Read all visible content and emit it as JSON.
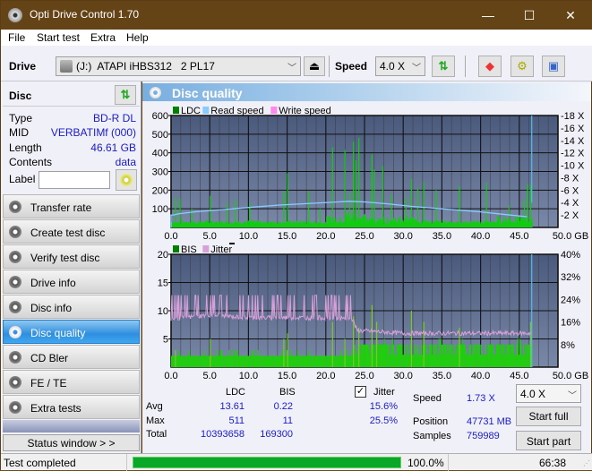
{
  "window": {
    "title": "Opti Drive Control 1.70",
    "minimize_label": "—",
    "maximize_label": "☐",
    "close_label": "✕"
  },
  "menu": [
    "File",
    "Start test",
    "Extra",
    "Help"
  ],
  "toolbar": {
    "drive_label": "Drive",
    "drive_value": "(J:)  ATAPI iHBS312   2 PL17",
    "speed_label": "Speed",
    "speed_value": "4.0 X",
    "icons": [
      "eject-icon",
      "refresh-icon",
      "erase-icon",
      "settings-icon",
      "save-icon"
    ]
  },
  "disc": {
    "header": "Disc",
    "rows": [
      {
        "key": "Type",
        "value": "BD-R DL"
      },
      {
        "key": "MID",
        "value": "VERBATIMf (000)"
      },
      {
        "key": "Length",
        "value": "46.61 GB"
      },
      {
        "key": "Contents",
        "value": "data"
      }
    ],
    "label_key": "Label",
    "label_value": ""
  },
  "nav": [
    {
      "label": "Transfer rate",
      "active": false
    },
    {
      "label": "Create test disc",
      "active": false
    },
    {
      "label": "Verify test disc",
      "active": false
    },
    {
      "label": "Drive info",
      "active": false
    },
    {
      "label": "Disc info",
      "active": false
    },
    {
      "label": "Disc quality",
      "active": true
    },
    {
      "label": "CD Bler",
      "active": false
    },
    {
      "label": "FE / TE",
      "active": false
    },
    {
      "label": "Extra tests",
      "active": false
    }
  ],
  "status_window_label": "Status window > >",
  "panel_title": "Disc quality",
  "chart_data": [
    {
      "type": "bar",
      "title": "LDC",
      "legend": [
        {
          "name": "LDC",
          "color": "#008000"
        },
        {
          "name": "Read speed",
          "color": "#88ccff"
        },
        {
          "name": "Write speed",
          "color": "#ff88ee"
        }
      ],
      "legend_position": "top-left",
      "xlabel": "GB",
      "xlim": [
        0,
        50
      ],
      "x_ticks": [
        "0.0",
        "5.0",
        "10.0",
        "15.0",
        "20.0",
        "25.0",
        "30.0",
        "35.0",
        "40.0",
        "45.0",
        "50.0 GB"
      ],
      "ylim": [
        0,
        600
      ],
      "y_ticks": [
        "100",
        "200",
        "300",
        "400",
        "500",
        "600"
      ],
      "y2lim": [
        0,
        18
      ],
      "y2_ticks": [
        "2 X",
        "4 X",
        "6 X",
        "8 X",
        "10 X",
        "12 X",
        "14 X",
        "16 X",
        "18 X"
      ],
      "grid": true,
      "end_marker_gb": 46.61,
      "ldc_peaks": [
        [
          0.5,
          160
        ],
        [
          1.1,
          155
        ],
        [
          2.6,
          100
        ],
        [
          5.0,
          170
        ],
        [
          7.2,
          130
        ],
        [
          8.2,
          150
        ],
        [
          10.1,
          130
        ],
        [
          14.5,
          195
        ],
        [
          15.0,
          290
        ],
        [
          17.7,
          195
        ],
        [
          19.2,
          100
        ],
        [
          20.8,
          430
        ],
        [
          22.4,
          415
        ],
        [
          23.0,
          185
        ],
        [
          23.5,
          460
        ],
        [
          23.8,
          360
        ],
        [
          24.2,
          480
        ],
        [
          25.9,
          390
        ],
        [
          26.2,
          310
        ],
        [
          27.3,
          330
        ],
        [
          28.4,
          175
        ],
        [
          30.3,
          160
        ],
        [
          31.0,
          260
        ],
        [
          31.8,
          210
        ],
        [
          32.6,
          240
        ],
        [
          34.2,
          200
        ],
        [
          37.2,
          220
        ],
        [
          40.7,
          240
        ],
        [
          43.6,
          120
        ],
        [
          45.6,
          150
        ],
        [
          46.0,
          230
        ],
        [
          46.4,
          230
        ]
      ],
      "ldc_baseline": 15,
      "read_speed": [
        [
          0.0,
          2.0
        ],
        [
          0.3,
          2.0
        ],
        [
          1.0,
          2.2
        ],
        [
          3.0,
          2.5
        ],
        [
          5.0,
          2.7
        ],
        [
          8.0,
          3.0
        ],
        [
          11.0,
          3.3
        ],
        [
          14.0,
          3.6
        ],
        [
          17.0,
          3.8
        ],
        [
          20.0,
          4.0
        ],
        [
          23.0,
          4.2
        ],
        [
          25.0,
          4.1
        ],
        [
          28.0,
          3.8
        ],
        [
          31.0,
          3.4
        ],
        [
          34.0,
          3.1
        ],
        [
          37.0,
          2.8
        ],
        [
          40.0,
          2.5
        ],
        [
          43.0,
          2.1
        ],
        [
          46.0,
          1.73
        ]
      ]
    },
    {
      "type": "bar",
      "title": "BIS / Jitter",
      "legend": [
        {
          "name": "BIS",
          "color": "#008000"
        },
        {
          "name": "Jitter",
          "color": "#d8a0d8"
        }
      ],
      "legend_position": "top-left",
      "xlabel": "GB",
      "xlim": [
        0,
        50
      ],
      "x_ticks": [
        "0.0",
        "5.0",
        "10.0",
        "15.0",
        "20.0",
        "25.0",
        "30.0",
        "35.0",
        "40.0",
        "45.0",
        "50.0 GB"
      ],
      "ylim": [
        0,
        20
      ],
      "y_ticks": [
        "5",
        "10",
        "15",
        "20"
      ],
      "y2lim": [
        0,
        40
      ],
      "y2_ticks": [
        "8%",
        "16%",
        "24%",
        "32%",
        "40%"
      ],
      "grid": true,
      "end_marker_gb": 46.61,
      "bis_baseline_first": 2,
      "bis_baseline_second": 4,
      "bis_peaks": [
        [
          0.5,
          3
        ],
        [
          5.0,
          5
        ],
        [
          14.5,
          5
        ],
        [
          15.0,
          6
        ],
        [
          20.8,
          8
        ],
        [
          22.4,
          5
        ],
        [
          23.5,
          9
        ],
        [
          24.2,
          7
        ],
        [
          25.9,
          11
        ],
        [
          26.5,
          8
        ],
        [
          31.0,
          10
        ],
        [
          32.6,
          8
        ],
        [
          37.2,
          7
        ],
        [
          46.4,
          8
        ]
      ],
      "jitter_percent": [
        [
          0.0,
          17
        ],
        [
          5.0,
          18.5
        ],
        [
          10.0,
          17.5
        ],
        [
          15.0,
          17.5
        ],
        [
          20.0,
          17.5
        ],
        [
          23.5,
          17
        ],
        [
          24.0,
          13
        ],
        [
          30.0,
          12
        ],
        [
          40.0,
          12
        ],
        [
          46.5,
          12
        ]
      ],
      "jitter_spike_percent": 25.5
    }
  ],
  "stats": {
    "col_ldc": "LDC",
    "col_bis": "BIS",
    "jitter_label": "Jitter",
    "jitter_checked": true,
    "rows": [
      {
        "label": "Avg",
        "ldc": "13.61",
        "bis": "0.22",
        "jitter": "15.6%"
      },
      {
        "label": "Max",
        "ldc": "511",
        "bis": "11",
        "jitter": "25.5%"
      },
      {
        "label": "Total",
        "ldc": "10393658",
        "bis": "169300",
        "jitter": ""
      }
    ],
    "speed_label": "Speed",
    "speed_value": "1.73 X",
    "position_label": "Position",
    "position_value": "47731 MB",
    "samples_label": "Samples",
    "samples_value": "759989",
    "speed_select": "4.0 X",
    "start_full": "Start full",
    "start_part": "Start part"
  },
  "statusbar": {
    "text": "Test completed",
    "progress_percent": 100,
    "progress_label": "100.0%",
    "time": "66:38"
  }
}
